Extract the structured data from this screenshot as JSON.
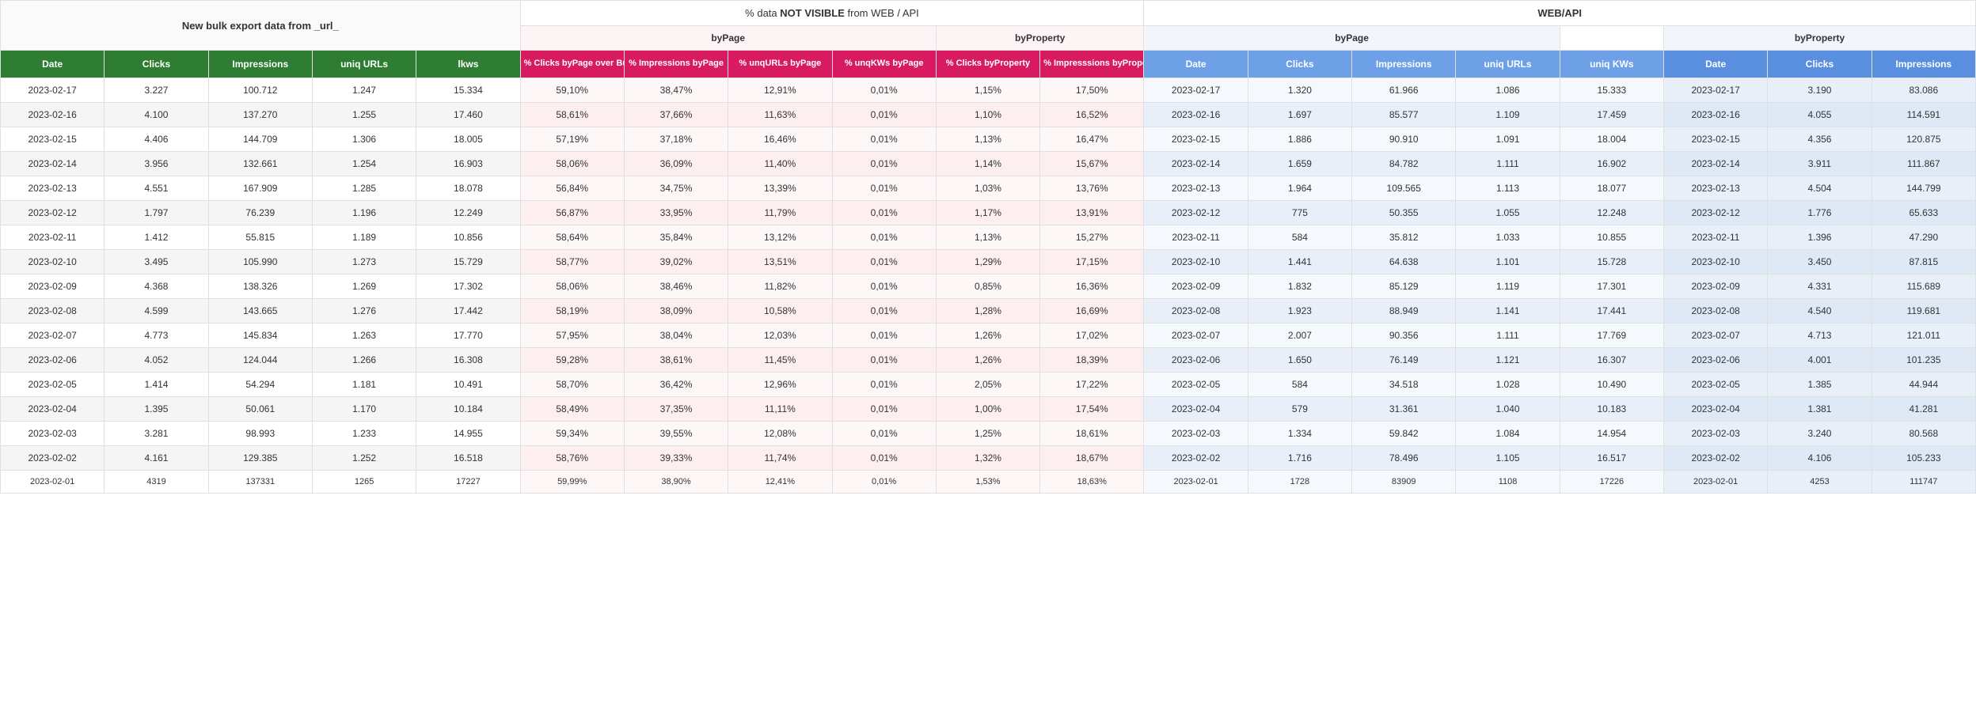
{
  "sections": {
    "bulk": "New bulk export  data from _url_",
    "notvis_pre": "% data ",
    "notvis_bold": "NOT VISIBLE",
    "notvis_post": " from WEB / API",
    "webapi": "WEB/API"
  },
  "subsections": {
    "byPage": "byPage",
    "byProperty": "byProperty"
  },
  "headers": {
    "green": [
      "Date",
      "Clicks",
      "Impressions",
      "uniq URLs",
      "lkws"
    ],
    "magenta": [
      "% Clicks byPage over Bulk Export",
      "% Impressions byPage",
      "% unqURLs byPage",
      "% unqKWs byPage",
      "% Clicks byProperty",
      "% Impresssions byProperty"
    ],
    "blue1": [
      "Date",
      "Clicks",
      "Impressions",
      "uniq URLs",
      "uniq KWs"
    ],
    "blue2": [
      "Date",
      "Clicks",
      "Impressions"
    ]
  },
  "rows": [
    [
      "2023-02-17",
      "3.227",
      "100.712",
      "1.247",
      "15.334",
      "59,10%",
      "38,47%",
      "12,91%",
      "0,01%",
      "1,15%",
      "17,50%",
      "2023-02-17",
      "1.320",
      "61.966",
      "1.086",
      "15.333",
      "2023-02-17",
      "3.190",
      "83.086"
    ],
    [
      "2023-02-16",
      "4.100",
      "137.270",
      "1.255",
      "17.460",
      "58,61%",
      "37,66%",
      "11,63%",
      "0,01%",
      "1,10%",
      "16,52%",
      "2023-02-16",
      "1.697",
      "85.577",
      "1.109",
      "17.459",
      "2023-02-16",
      "4.055",
      "114.591"
    ],
    [
      "2023-02-15",
      "4.406",
      "144.709",
      "1.306",
      "18.005",
      "57,19%",
      "37,18%",
      "16,46%",
      "0,01%",
      "1,13%",
      "16,47%",
      "2023-02-15",
      "1.886",
      "90.910",
      "1.091",
      "18.004",
      "2023-02-15",
      "4.356",
      "120.875"
    ],
    [
      "2023-02-14",
      "3.956",
      "132.661",
      "1.254",
      "16.903",
      "58,06%",
      "36,09%",
      "11,40%",
      "0,01%",
      "1,14%",
      "15,67%",
      "2023-02-14",
      "1.659",
      "84.782",
      "1.111",
      "16.902",
      "2023-02-14",
      "3.911",
      "111.867"
    ],
    [
      "2023-02-13",
      "4.551",
      "167.909",
      "1.285",
      "18.078",
      "56,84%",
      "34,75%",
      "13,39%",
      "0,01%",
      "1,03%",
      "13,76%",
      "2023-02-13",
      "1.964",
      "109.565",
      "1.113",
      "18.077",
      "2023-02-13",
      "4.504",
      "144.799"
    ],
    [
      "2023-02-12",
      "1.797",
      "76.239",
      "1.196",
      "12.249",
      "56,87%",
      "33,95%",
      "11,79%",
      "0,01%",
      "1,17%",
      "13,91%",
      "2023-02-12",
      "775",
      "50.355",
      "1.055",
      "12.248",
      "2023-02-12",
      "1.776",
      "65.633"
    ],
    [
      "2023-02-11",
      "1.412",
      "55.815",
      "1.189",
      "10.856",
      "58,64%",
      "35,84%",
      "13,12%",
      "0,01%",
      "1,13%",
      "15,27%",
      "2023-02-11",
      "584",
      "35.812",
      "1.033",
      "10.855",
      "2023-02-11",
      "1.396",
      "47.290"
    ],
    [
      "2023-02-10",
      "3.495",
      "105.990",
      "1.273",
      "15.729",
      "58,77%",
      "39,02%",
      "13,51%",
      "0,01%",
      "1,29%",
      "17,15%",
      "2023-02-10",
      "1.441",
      "64.638",
      "1.101",
      "15.728",
      "2023-02-10",
      "3.450",
      "87.815"
    ],
    [
      "2023-02-09",
      "4.368",
      "138.326",
      "1.269",
      "17.302",
      "58,06%",
      "38,46%",
      "11,82%",
      "0,01%",
      "0,85%",
      "16,36%",
      "2023-02-09",
      "1.832",
      "85.129",
      "1.119",
      "17.301",
      "2023-02-09",
      "4.331",
      "115.689"
    ],
    [
      "2023-02-08",
      "4.599",
      "143.665",
      "1.276",
      "17.442",
      "58,19%",
      "38,09%",
      "10,58%",
      "0,01%",
      "1,28%",
      "16,69%",
      "2023-02-08",
      "1.923",
      "88.949",
      "1.141",
      "17.441",
      "2023-02-08",
      "4.540",
      "119.681"
    ],
    [
      "2023-02-07",
      "4.773",
      "145.834",
      "1.263",
      "17.770",
      "57,95%",
      "38,04%",
      "12,03%",
      "0,01%",
      "1,26%",
      "17,02%",
      "2023-02-07",
      "2.007",
      "90.356",
      "1.111",
      "17.769",
      "2023-02-07",
      "4.713",
      "121.011"
    ],
    [
      "2023-02-06",
      "4.052",
      "124.044",
      "1.266",
      "16.308",
      "59,28%",
      "38,61%",
      "11,45%",
      "0,01%",
      "1,26%",
      "18,39%",
      "2023-02-06",
      "1.650",
      "76.149",
      "1.121",
      "16.307",
      "2023-02-06",
      "4.001",
      "101.235"
    ],
    [
      "2023-02-05",
      "1.414",
      "54.294",
      "1.181",
      "10.491",
      "58,70%",
      "36,42%",
      "12,96%",
      "0,01%",
      "2,05%",
      "17,22%",
      "2023-02-05",
      "584",
      "34.518",
      "1.028",
      "10.490",
      "2023-02-05",
      "1.385",
      "44.944"
    ],
    [
      "2023-02-04",
      "1.395",
      "50.061",
      "1.170",
      "10.184",
      "58,49%",
      "37,35%",
      "11,11%",
      "0,01%",
      "1,00%",
      "17,54%",
      "2023-02-04",
      "579",
      "31.361",
      "1.040",
      "10.183",
      "2023-02-04",
      "1.381",
      "41.281"
    ],
    [
      "2023-02-03",
      "3.281",
      "98.993",
      "1.233",
      "14.955",
      "59,34%",
      "39,55%",
      "12,08%",
      "0,01%",
      "1,25%",
      "18,61%",
      "2023-02-03",
      "1.334",
      "59.842",
      "1.084",
      "14.954",
      "2023-02-03",
      "3.240",
      "80.568"
    ],
    [
      "2023-02-02",
      "4.161",
      "129.385",
      "1.252",
      "16.518",
      "58,76%",
      "39,33%",
      "11,74%",
      "0,01%",
      "1,32%",
      "18,67%",
      "2023-02-02",
      "1.716",
      "78.496",
      "1.105",
      "16.517",
      "2023-02-02",
      "4.106",
      "105.233"
    ],
    [
      "2023-02-01",
      "4319",
      "137331",
      "1265",
      "17227",
      "59,99%",
      "38,90%",
      "12,41%",
      "0,01%",
      "1,53%",
      "18,63%",
      "2023-02-01",
      "1728",
      "83909",
      "1108",
      "17226",
      "2023-02-01",
      "4253",
      "111747"
    ]
  ]
}
